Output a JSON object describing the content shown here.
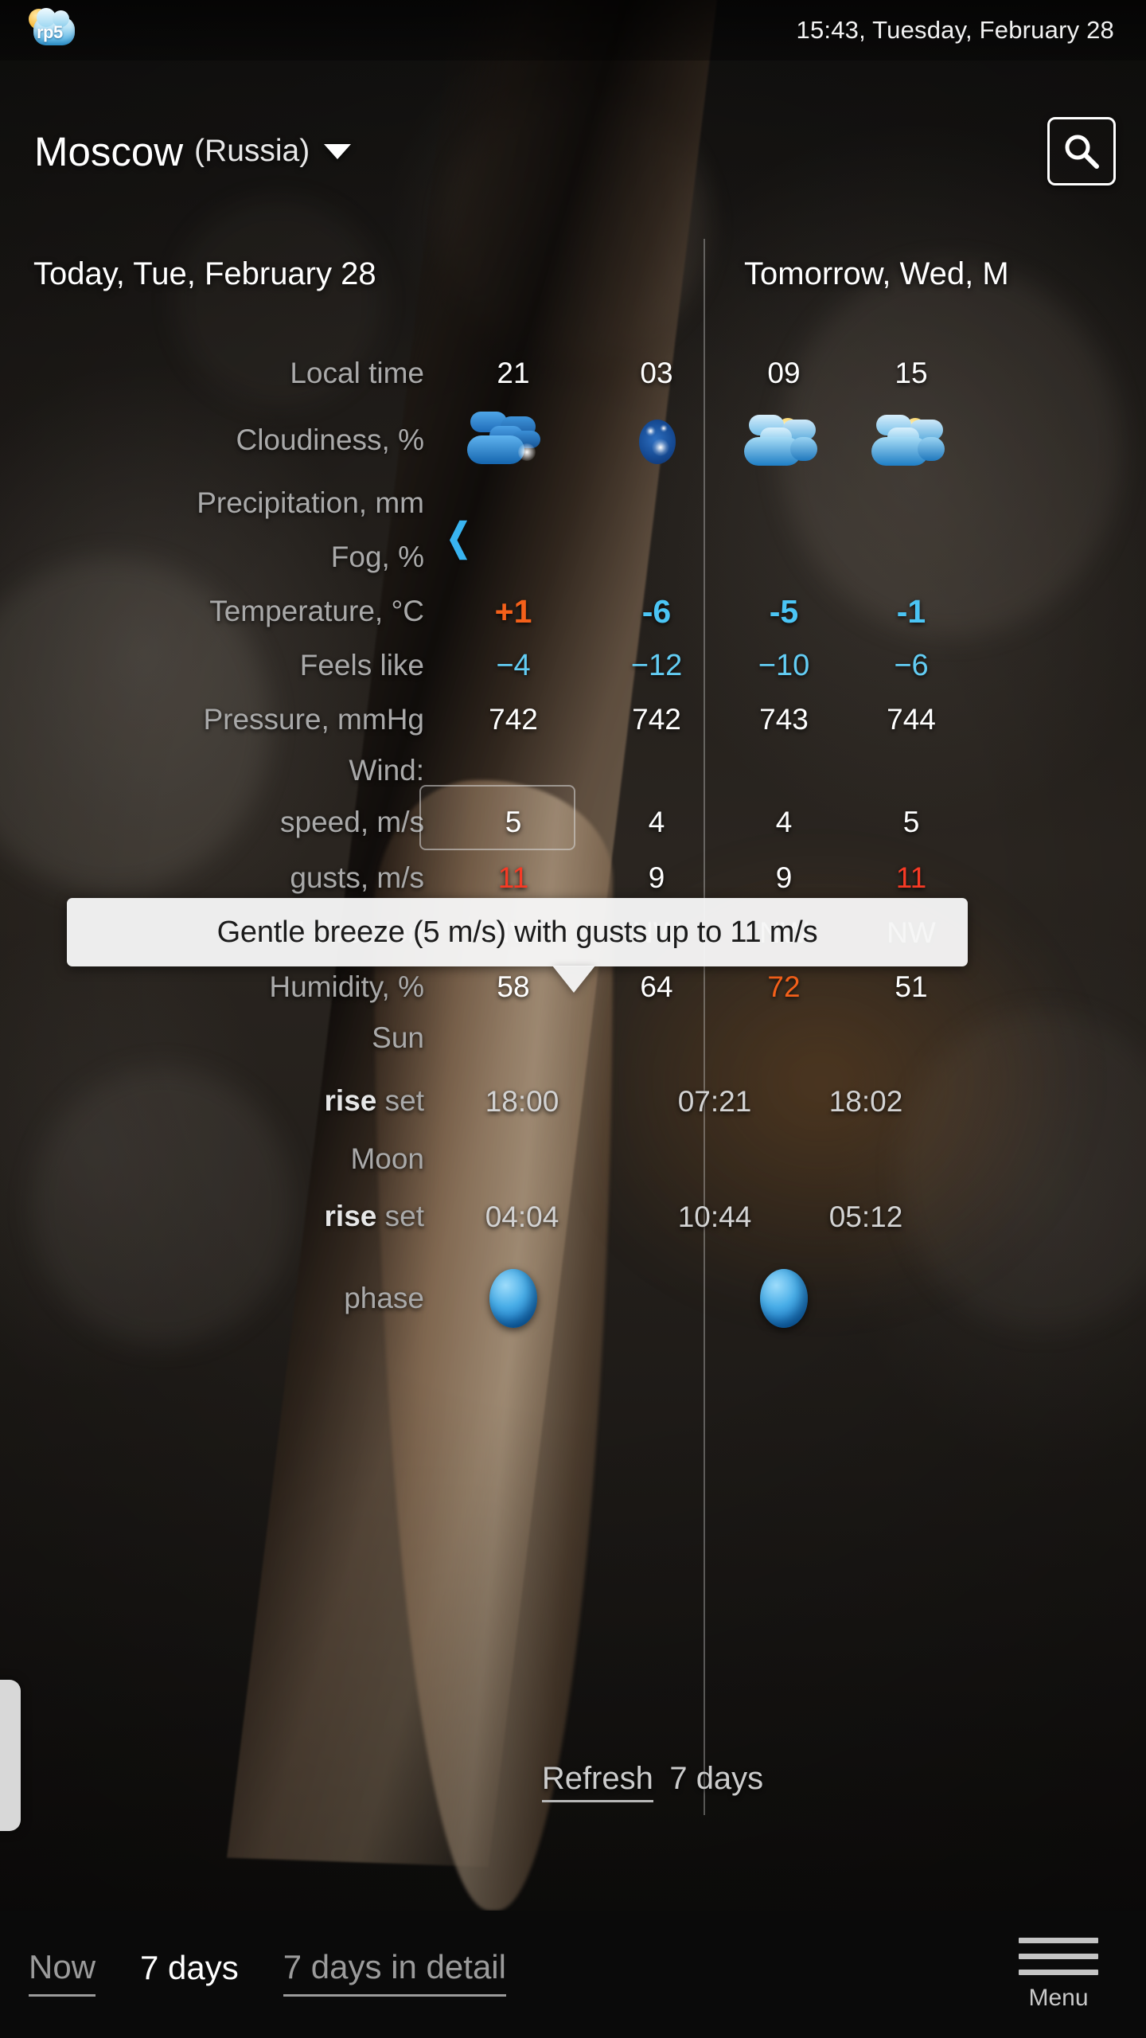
{
  "status_bar": {
    "app_logo_text": "rp5",
    "datetime": "15:43, Tuesday, February 28"
  },
  "header": {
    "city": "Moscow",
    "country": "(Russia)",
    "dropdown_icon": "chevron-down-icon",
    "search_icon": "search-icon"
  },
  "days": [
    {
      "label": "Today, Tue, February 28"
    },
    {
      "label": "Tomorrow, Wed, M"
    }
  ],
  "row_labels": {
    "local_time": "Local time",
    "cloudiness": "Cloudiness, %",
    "precipitation": "Precipitation, mm",
    "fog": "Fog, %",
    "temperature": "Temperature, °C",
    "feels_like": "Feels like",
    "pressure": "Pressure, mmHg",
    "wind": "Wind:",
    "wind_speed": "speed, m/s",
    "wind_gusts": "gusts, m/s",
    "wind_direction": "wind direction",
    "humidity": "Humidity, %",
    "sun": "Sun",
    "sun_riseset_rise": "rise",
    "sun_riseset_set": "set",
    "moon": "Moon",
    "moon_riseset_rise": "rise",
    "moon_riseset_set": "set",
    "phase": "phase"
  },
  "columns": [
    {
      "local_time": "21",
      "cloudiness_icon": "cloudy-icon",
      "precipitation": "",
      "fog": "",
      "temperature": "+1",
      "temperature_sign": "positive",
      "feels_like": "−4",
      "pressure": "742",
      "wind_speed": "5",
      "wind_speed_highlighted": true,
      "wind_gusts": "11",
      "wind_gusts_high": true,
      "wind_direction": "NW",
      "humidity": "58",
      "humidity_high": false
    },
    {
      "local_time": "03",
      "cloudiness_icon": "clear-night-icon",
      "precipitation": "",
      "fog": "",
      "temperature": "-6",
      "temperature_sign": "negative",
      "feels_like": "−12",
      "pressure": "742",
      "wind_speed": "4",
      "wind_speed_highlighted": false,
      "wind_gusts": "9",
      "wind_gusts_high": false,
      "wind_direction": "NW",
      "humidity": "64",
      "humidity_high": false
    },
    {
      "local_time": "09",
      "cloudiness_icon": "partly-cloudy-icon",
      "precipitation": "",
      "fog": "",
      "temperature": "-5",
      "temperature_sign": "negative",
      "feels_like": "−10",
      "pressure": "743",
      "wind_speed": "4",
      "wind_speed_highlighted": false,
      "wind_gusts": "9",
      "wind_gusts_high": false,
      "wind_direction": "NW",
      "humidity": "72",
      "humidity_high": true
    },
    {
      "local_time": "15",
      "cloudiness_icon": "partly-cloudy-icon",
      "precipitation": "",
      "fog": "",
      "temperature": "-1",
      "temperature_sign": "negative",
      "feels_like": "−6",
      "pressure": "744",
      "wind_speed": "5",
      "wind_speed_highlighted": false,
      "wind_gusts": "11",
      "wind_gusts_high": true,
      "wind_direction": "NW",
      "humidity": "51",
      "humidity_high": false
    }
  ],
  "astro": {
    "today": {
      "sun_rise": "",
      "sun_set": "18:00",
      "moon_rise": "",
      "moon_set": "04:04",
      "phase_icon": "moon-phase-icon"
    },
    "tomorrow": {
      "sun_rise": "07:21",
      "sun_set": "18:02",
      "moon_rise": "10:44",
      "moon_set": "05:12",
      "phase_icon": "moon-phase-icon"
    }
  },
  "tooltip": {
    "text": "Gentle breeze (5 m/s) with gusts up to 11 m/s"
  },
  "scroll_hint_icon": "chevron-left-icon",
  "refresh": {
    "link_label": "Refresh",
    "suffix_label": "7 days"
  },
  "bottom_nav": {
    "items": [
      {
        "label": "Now",
        "active": false
      },
      {
        "label": "7 days",
        "active": true
      },
      {
        "label": "7 days in detail",
        "active": false
      }
    ],
    "menu_label": "Menu",
    "menu_icon": "hamburger-menu-icon"
  },
  "colors": {
    "temp_positive": "#f4601a",
    "temp_negative": "#4bc5f5",
    "feels_like": "#63cdf4",
    "gust_high": "#f73a25",
    "humidity_high": "#f4601a",
    "label_gray": "#a9a9a9",
    "scroll_hint": "#39b4f0"
  }
}
